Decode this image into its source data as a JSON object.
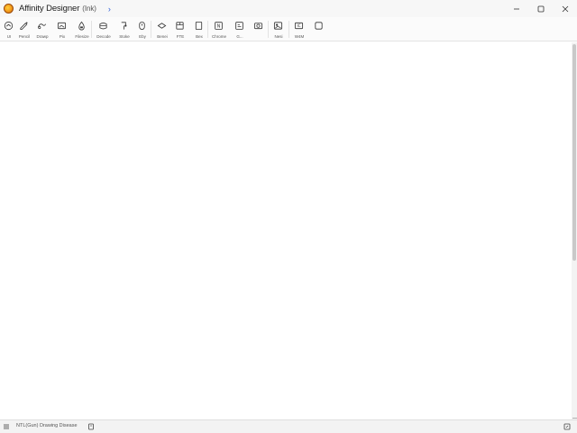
{
  "window": {
    "app_title": "Affinity Designer",
    "app_title_sub": "(Ink)",
    "title_chevron": "›",
    "controls": [
      "minimize-icon",
      "maximize-icon",
      "close-icon"
    ]
  },
  "toolbar": {
    "tools": [
      {
        "icon": "home-icon",
        "label": "UI"
      },
      {
        "icon": "pen-icon",
        "label": "Pencil"
      },
      {
        "icon": "brush-icon",
        "label": "Drawp"
      },
      {
        "icon": "image-icon",
        "label": "Pix"
      },
      {
        "icon": "fill-icon",
        "label": "Filesize"
      },
      {
        "icon": "layers-icon",
        "label": "Decode"
      },
      {
        "icon": "node-icon",
        "label": "Stoke"
      },
      {
        "icon": "brush-round-icon",
        "label": "Eby"
      },
      {
        "icon": "shape-icon",
        "label": "Benei"
      },
      {
        "icon": "crop-icon",
        "label": "FTE"
      },
      {
        "icon": "page-icon",
        "label": "Bex"
      },
      {
        "icon": "text-frame-icon",
        "label": "Chrome"
      },
      {
        "icon": "text-icon",
        "label": "G..."
      },
      {
        "icon": "gallery-icon",
        "label": ""
      },
      {
        "icon": "photo-icon",
        "label": "Nesi"
      },
      {
        "icon": "media-icon",
        "label": "W4M"
      },
      {
        "icon": "square-icon",
        "label": ""
      }
    ]
  },
  "status": {
    "text": "NTL(Gun) Drawing Disease",
    "left_icon": "list-icon",
    "mid_icon": "document-icon",
    "right_icon": "resize-icon"
  },
  "colors": {
    "accent": "#2a5bd7",
    "logo_orange": "#f39a1c",
    "scroll_thumb": "#c9c9c9"
  }
}
